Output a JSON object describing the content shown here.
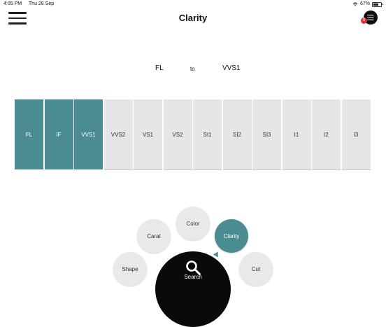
{
  "status_bar": {
    "time": "4:05 PM",
    "date": "Thu 28 Sep",
    "battery": "67%",
    "battery_level": 0.67
  },
  "header": {
    "title": "Clarity",
    "notification_count": "0"
  },
  "range": {
    "from": "FL",
    "separator": "to",
    "to": "VVS1"
  },
  "grades": [
    {
      "label": "FL",
      "selected": true
    },
    {
      "label": "IF",
      "selected": true
    },
    {
      "label": "VVS1",
      "selected": true
    },
    {
      "label": "VVS2",
      "selected": false
    },
    {
      "label": "VS1",
      "selected": false
    },
    {
      "label": "VS2",
      "selected": false
    },
    {
      "label": "SI1",
      "selected": false
    },
    {
      "label": "SI2",
      "selected": false
    },
    {
      "label": "SI3",
      "selected": false
    },
    {
      "label": "I1",
      "selected": false
    },
    {
      "label": "I2",
      "selected": false
    },
    {
      "label": "I3",
      "selected": false
    }
  ],
  "nav": {
    "shape": "Shape",
    "carat": "Carat",
    "color": "Color",
    "clarity": "Clarity",
    "cut": "Cut",
    "search": "Search",
    "active": "clarity"
  },
  "colors": {
    "accent": "#4a8c91",
    "tile": "#e6e6e6",
    "dark": "#0a0a0a",
    "badge": "#d9343b"
  }
}
